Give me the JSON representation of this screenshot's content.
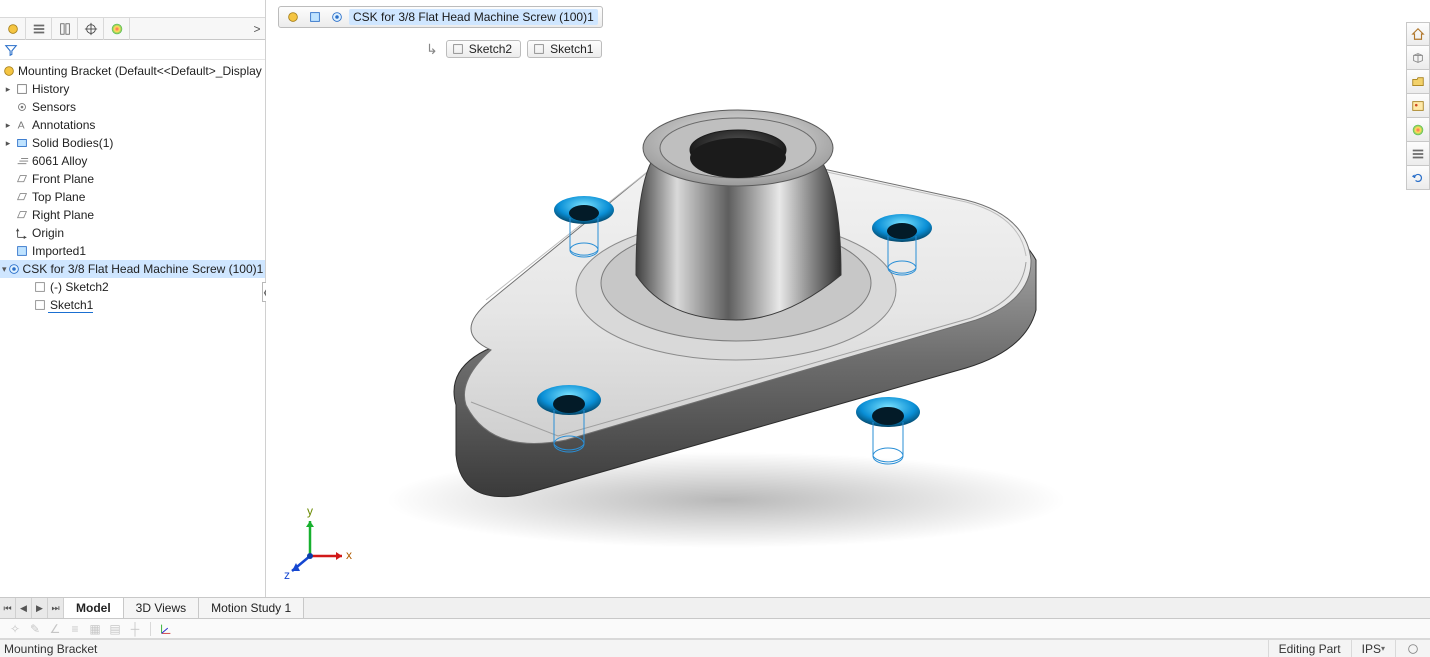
{
  "panel": {
    "toolbar_icons": [
      "assembly-icon",
      "list-icon",
      "measure-icon",
      "target-icon",
      "appearance-icon"
    ],
    "root_label": "Mounting Bracket  (Default<<Default>_Display !",
    "items": [
      {
        "label": "History",
        "icon": "history-icon",
        "indent": 1,
        "twist": "▸"
      },
      {
        "label": "Sensors",
        "icon": "sensors-icon",
        "indent": 1,
        "twist": ""
      },
      {
        "label": "Annotations",
        "icon": "annotations-icon",
        "indent": 1,
        "twist": "▸"
      },
      {
        "label": "Solid Bodies(1)",
        "icon": "solidbody-icon",
        "indent": 1,
        "twist": "▸"
      },
      {
        "label": "6061 Alloy",
        "icon": "material-icon",
        "indent": 1,
        "twist": ""
      },
      {
        "label": "Front Plane",
        "icon": "plane-icon",
        "indent": 1,
        "twist": ""
      },
      {
        "label": "Top Plane",
        "icon": "plane-icon",
        "indent": 1,
        "twist": ""
      },
      {
        "label": "Right Plane",
        "icon": "plane-icon",
        "indent": 1,
        "twist": ""
      },
      {
        "label": "Origin",
        "icon": "origin-icon",
        "indent": 1,
        "twist": ""
      },
      {
        "label": "Imported1",
        "icon": "imported-icon",
        "indent": 1,
        "twist": ""
      },
      {
        "label": "CSK for 3/8 Flat Head Machine Screw (100)1",
        "icon": "hole-icon",
        "indent": 1,
        "twist": "▾",
        "selected": true
      },
      {
        "label": "(-) Sketch2",
        "icon": "sketch-icon",
        "indent": 2,
        "twist": ""
      },
      {
        "label": "Sketch1",
        "icon": "sketch-icon",
        "indent": 2,
        "twist": "",
        "underlined": true
      }
    ]
  },
  "breadcrumb": {
    "feature_label": "CSK for 3/8 Flat Head Machine Screw (100)1",
    "chips": [
      "Sketch2",
      "Sketch1"
    ]
  },
  "right_toolbar": [
    "home-icon",
    "cube-icon",
    "open-icon",
    "image-icon",
    "appearance-icon",
    "list-icon",
    "reload-icon"
  ],
  "tabs": {
    "nav": [
      "⏮",
      "◀",
      "▶",
      "⏭"
    ],
    "items": [
      "Model",
      "3D Views",
      "Motion Study 1"
    ],
    "active": 0
  },
  "mini_toolbar": [
    "wand",
    "pencil",
    "angle",
    "lines",
    "grid",
    "grid2",
    "axis",
    "triad"
  ],
  "status": {
    "doc": "Mounting Bracket",
    "mode": "Editing Part",
    "units": "IPS"
  },
  "triad": {
    "x": "x",
    "y": "y",
    "z": "z"
  }
}
